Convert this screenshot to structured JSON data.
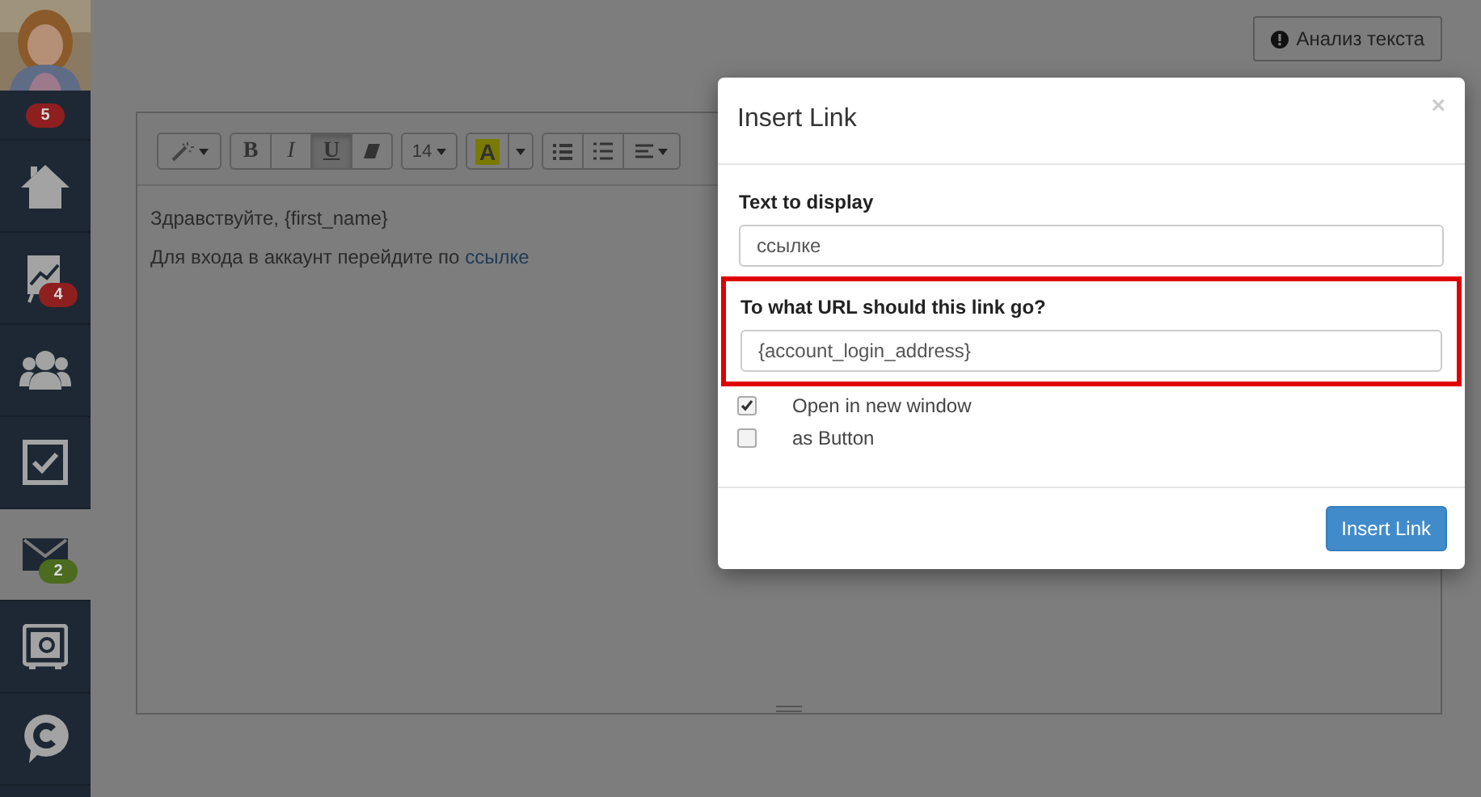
{
  "sidebar": {
    "avatar_badge": {
      "text": "5",
      "color": "#8e1f1f"
    },
    "items": [
      {
        "kind": "home",
        "selected": false
      },
      {
        "kind": "chart",
        "selected": false,
        "badge": {
          "text": "4",
          "color": "#8e1f1f"
        }
      },
      {
        "kind": "people",
        "selected": false
      },
      {
        "kind": "tasks",
        "selected": false
      },
      {
        "kind": "mail",
        "selected": true,
        "badge": {
          "text": "2",
          "color": "#4b6b1e"
        }
      },
      {
        "kind": "safe",
        "selected": false
      },
      {
        "kind": "chat",
        "selected": false
      }
    ]
  },
  "analyze_button": "Анализ текста",
  "editor": {
    "toolbar": [
      {
        "buttons": [
          {
            "kind": "magic",
            "selected": false
          }
        ]
      },
      {
        "buttons": [
          {
            "kind": "bold",
            "label": "B",
            "selected": false
          },
          {
            "kind": "italic",
            "label": "I",
            "selected": false
          },
          {
            "kind": "underline",
            "label": "U",
            "selected": true
          },
          {
            "kind": "eraser",
            "selected": false
          }
        ]
      },
      {
        "buttons": [
          {
            "kind": "fontsize",
            "label": "14",
            "selected": false
          }
        ]
      },
      {
        "buttons": [
          {
            "kind": "color",
            "label": "A",
            "selected": false
          },
          {
            "kind": "caret",
            "selected": false
          }
        ]
      },
      {
        "buttons": [
          {
            "kind": "ul",
            "selected": false
          },
          {
            "kind": "ol",
            "selected": false
          },
          {
            "kind": "align",
            "selected": false
          }
        ]
      }
    ],
    "lines": [
      {
        "text": "Здравствуйте, {first_name}"
      },
      {
        "text": "Для входа в аккаунт перейдите по ",
        "link": "ссылке"
      }
    ]
  },
  "modal": {
    "title": "Insert Link",
    "close": "×",
    "fields": [
      {
        "label": "Text to display",
        "value": "ссылке",
        "highlighted": false
      },
      {
        "label": "To what URL should this link go?",
        "value": "{account_login_address}",
        "highlighted": true
      }
    ],
    "checkboxes": [
      {
        "label": "Open in new window",
        "checked": true
      },
      {
        "label": "as Button",
        "checked": false
      }
    ],
    "button": "Insert Link"
  }
}
